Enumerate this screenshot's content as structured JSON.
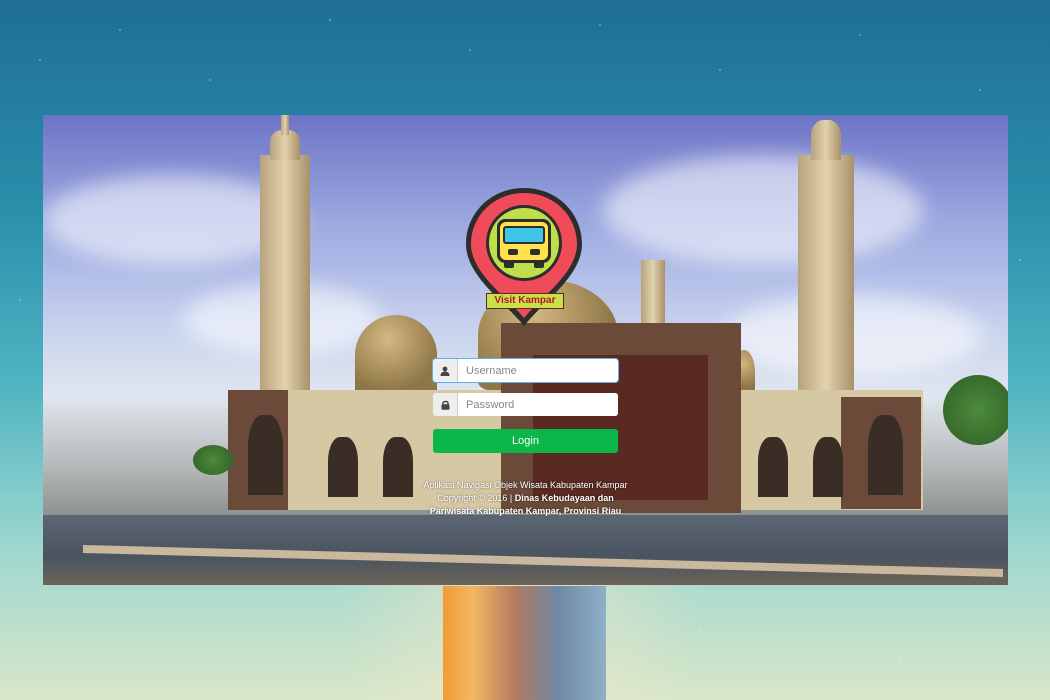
{
  "logo": {
    "text": "Visit Kampar",
    "pin_color": "#ef4b58",
    "inner_color": "#bde04a",
    "bus_color": "#ffe24d"
  },
  "login": {
    "username_placeholder": "Username",
    "password_placeholder": "Password",
    "button_label": "Login",
    "button_color": "#0ab748",
    "user_icon": "user-icon",
    "lock_icon": "lock-icon"
  },
  "footer": {
    "line1": "Aplikasi Navigasi Objek Wisata Kabupaten Kampar",
    "line2_prefix": "Copyright © 2016 | ",
    "line2_bold": "Dinas Kebudayaan dan",
    "line3_bold": "Pariwisata Kabupaten Kampar, Provinsi Riau"
  }
}
